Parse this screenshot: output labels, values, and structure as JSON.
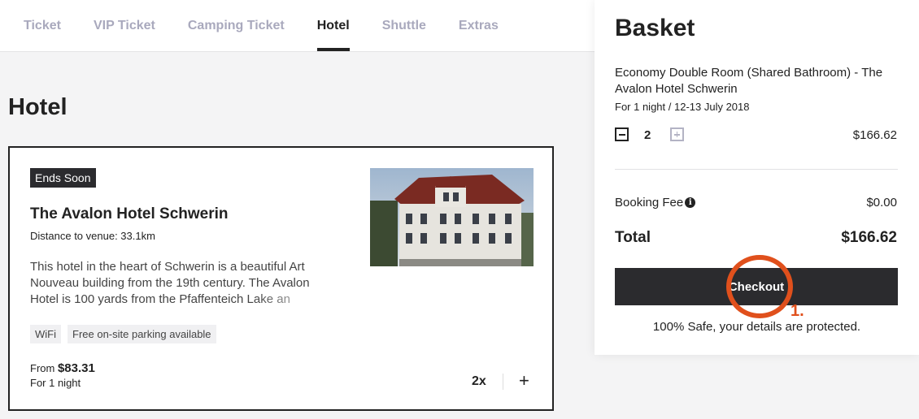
{
  "tabs": [
    {
      "label": "Ticket"
    },
    {
      "label": "VIP Ticket"
    },
    {
      "label": "Camping Ticket"
    },
    {
      "label": "Hotel"
    },
    {
      "label": "Shuttle"
    },
    {
      "label": "Extras"
    }
  ],
  "active_tab": "Hotel",
  "page": {
    "title": "Hotel"
  },
  "hotel": {
    "badge": "Ends Soon",
    "name": "The Avalon Hotel Schwerin",
    "distance": "Distance to venue: 33.1km",
    "description": "This hotel in the heart of Schwerin is a beautiful Art Nouveau building from the 19th century. The Avalon Hotel is 100 yards from the Pfaffenteich Lake an",
    "tags": [
      "WiFi",
      "Free on-site parking available"
    ],
    "price_prefix": "From ",
    "price": "$83.31",
    "nights": "For 1 night",
    "quantity": "2x"
  },
  "basket": {
    "title": "Basket",
    "item_name": "Economy Double Room (Shared Bathroom) - The Avalon Hotel Schwerin",
    "item_date": "For 1 night / 12-13 July 2018",
    "item_qty": "2",
    "item_price": "$166.62",
    "fee_label": "Booking Fee",
    "fee_value": "$0.00",
    "total_label": "Total",
    "total_value": "$166.62",
    "checkout_label": "Checkout",
    "safe_note": "100% Safe, your details are protected."
  },
  "annotation": {
    "label": "1.",
    "color": "#e0501c"
  }
}
